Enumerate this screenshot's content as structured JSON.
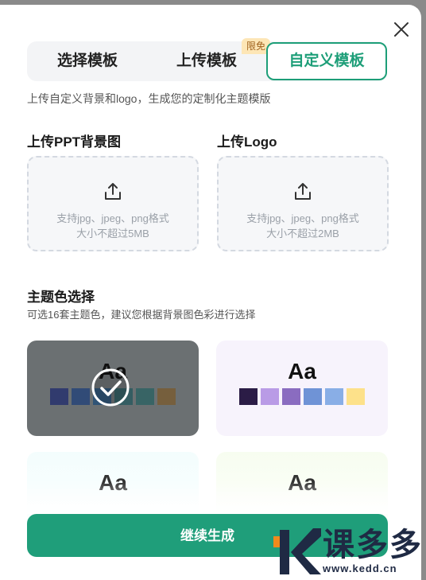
{
  "tabs": [
    {
      "label": "选择模板"
    },
    {
      "label": "上传模板",
      "badge": "限免"
    },
    {
      "label": "自定义模板",
      "active": true
    }
  ],
  "description": "上传自定义背景和logo，生成您的定制化主题模版",
  "upload_background": {
    "title": "上传PPT背景图",
    "icon": "upload-icon",
    "hint_line1": "支持jpg、jpeg、png格式",
    "hint_line2": "大小不超过5MB"
  },
  "upload_logo": {
    "title": "上传Logo",
    "icon": "upload-icon",
    "hint_line1": "支持jpg、jpeg、png格式",
    "hint_line2": "大小不超过2MB"
  },
  "theme_section": {
    "title": "主题色选择",
    "subtitle": "可选16套主题色，建议您根据背景图色彩进行选择"
  },
  "themes": [
    {
      "label": "Aa",
      "selected": true,
      "swatches": [
        "#1e2a6e",
        "#1d3f7a",
        "#1c4b78",
        "#22575d",
        "#276062",
        "#7a5a2c"
      ]
    },
    {
      "label": "Aa",
      "selected": false,
      "swatches": [
        "#2b1c46",
        "#b99be6",
        "#8a6cc0",
        "#6f93d6",
        "#89aee6",
        "#fde18a"
      ]
    },
    {
      "label": "Aa",
      "selected": false
    },
    {
      "label": "Aa",
      "selected": false
    }
  ],
  "continue_button": "继续生成",
  "watermark": {
    "brand": "课多多",
    "url": "www.kedd.cn"
  },
  "colors": {
    "accent": "#1f9e7a",
    "badge_bg": "#fde6b6"
  }
}
